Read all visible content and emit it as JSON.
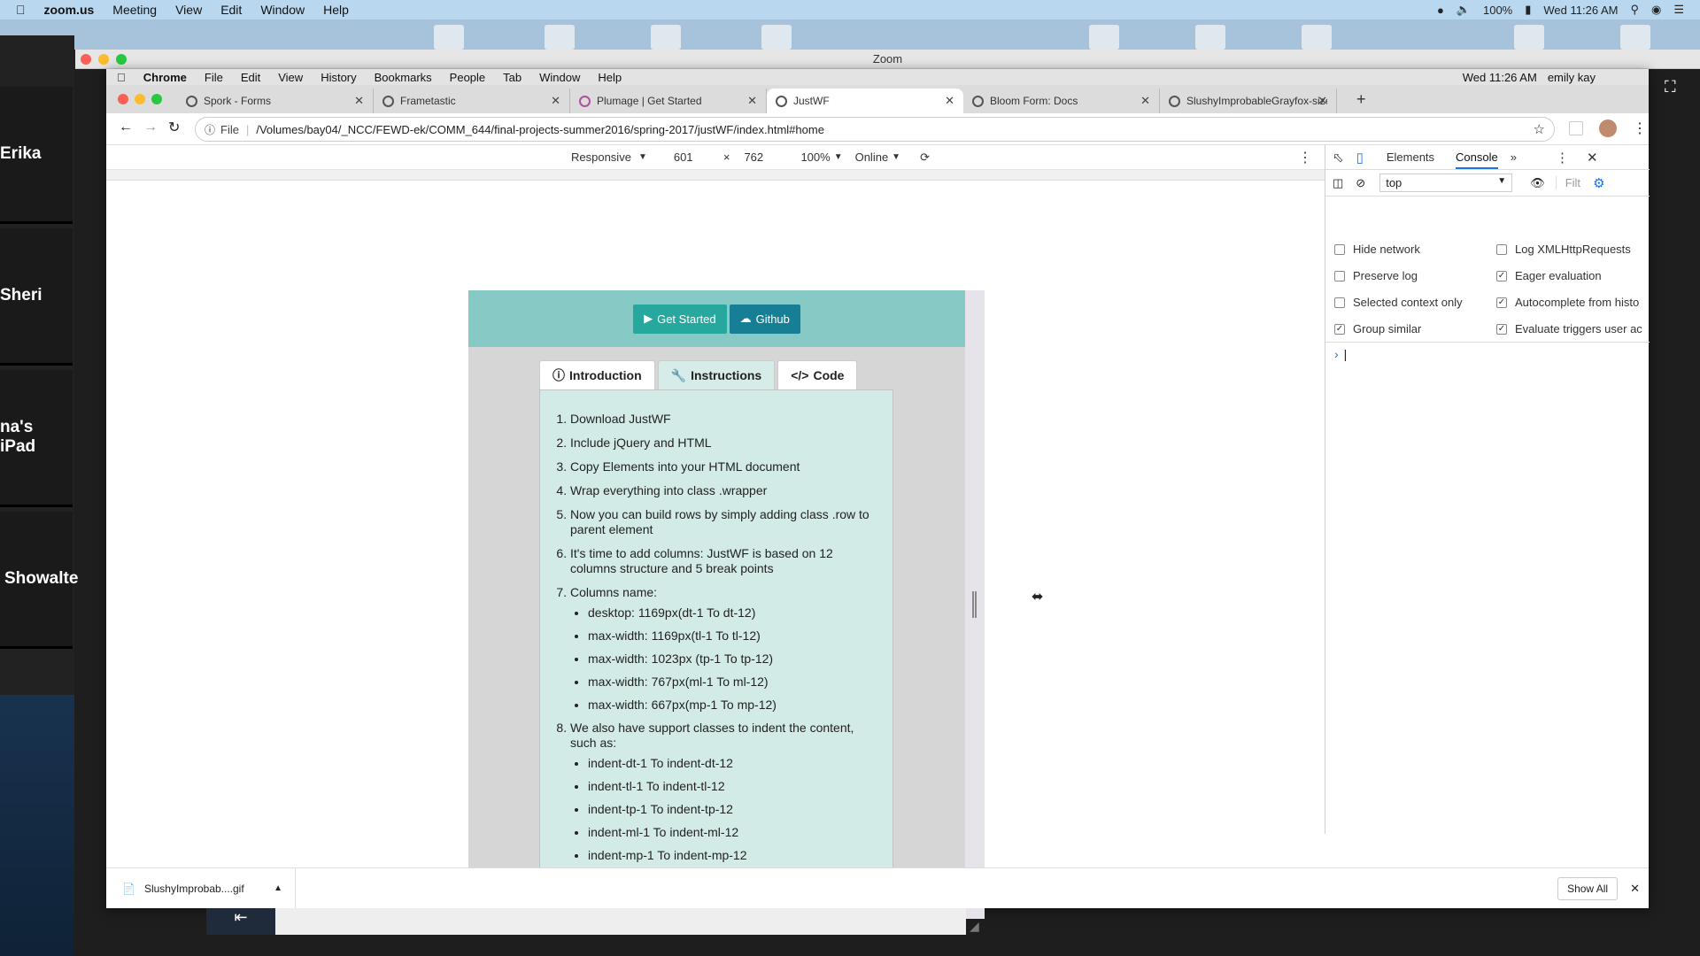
{
  "mac_menubar": {
    "app": "zoom.us",
    "menus": [
      "Meeting",
      "View",
      "Edit",
      "Window",
      "Help"
    ],
    "status_battery": "100%",
    "status_time": "Wed 11:26 AM"
  },
  "zoom": {
    "window_title": "Zoom",
    "participants": [
      "Erika",
      "Sheri",
      "na's iPad",
      "Showalte"
    ]
  },
  "chrome_menubar": {
    "app": "Chrome",
    "menus": [
      "File",
      "Edit",
      "View",
      "History",
      "Bookmarks",
      "People",
      "Tab",
      "Window",
      "Help"
    ],
    "time": "Wed 11:26 AM",
    "user": "emily kay"
  },
  "tabs": [
    {
      "label": "Spork - Forms"
    },
    {
      "label": "Frametastic"
    },
    {
      "label": "Plumage | Get Started"
    },
    {
      "label": "JustWF"
    },
    {
      "label": "Bloom Form: Docs"
    },
    {
      "label": "SlushyImprobableGrayfox-size"
    }
  ],
  "address": {
    "scheme_label": "File",
    "url": "/Volumes/bay04/_NCC/FEWD-ek/COMM_644/final-projects-summer2016/spring-2017/justWF/index.html#home"
  },
  "device_toolbar": {
    "mode": "Responsive",
    "width": "601",
    "times": "×",
    "height": "762",
    "zoom": "100%",
    "network": "Online"
  },
  "page": {
    "buttons": {
      "get_started": "Get Started",
      "github": "Github"
    },
    "tabs": {
      "intro": "Introduction",
      "instructions": "Instructions",
      "code": "Code"
    },
    "steps": [
      "Download JustWF",
      "Include jQuery and HTML",
      "Copy Elements into your HTML document",
      "Wrap everything into class .wrapper",
      "Now you can build rows by simply adding class .row to parent element",
      "It's time to add columns: JustWF is based on 12 columns structure and 5 break points",
      "Columns name:",
      "We also have support classes to indent the content, such as:"
    ],
    "columns": [
      "desktop: 1169px(dt-1 To dt-12)",
      "max-width: 1169px(tl-1 To tl-12)",
      "max-width: 1023px (tp-1 To tp-12)",
      "max-width: 767px(ml-1 To ml-12)",
      "max-width: 667px(mp-1 To mp-12)"
    ],
    "indents": [
      "indent-dt-1 To indent-dt-12",
      "indent-tl-1 To indent-tl-12",
      "indent-tp-1 To indent-tp-12",
      "indent-ml-1 To indent-ml-12",
      "indent-mp-1 To indent-mp-12"
    ]
  },
  "devtools": {
    "tabs": {
      "elements": "Elements",
      "console": "Console",
      "more": "»"
    },
    "context": "top",
    "filter_placeholder": "Filt",
    "settings": [
      {
        "label": "Hide network",
        "checked": false
      },
      {
        "label": "Log XMLHttpRequests",
        "checked": false
      },
      {
        "label": "Preserve log",
        "checked": false
      },
      {
        "label": "Eager evaluation",
        "checked": true
      },
      {
        "label": "Selected context only",
        "checked": false
      },
      {
        "label": "Autocomplete from histo",
        "checked": true
      },
      {
        "label": "Group similar",
        "checked": true
      },
      {
        "label": "Evaluate triggers user ac",
        "checked": true
      }
    ],
    "prompt": "›"
  },
  "downloads": {
    "file": "SlushyImprobab....gif",
    "show_all": "Show All"
  }
}
